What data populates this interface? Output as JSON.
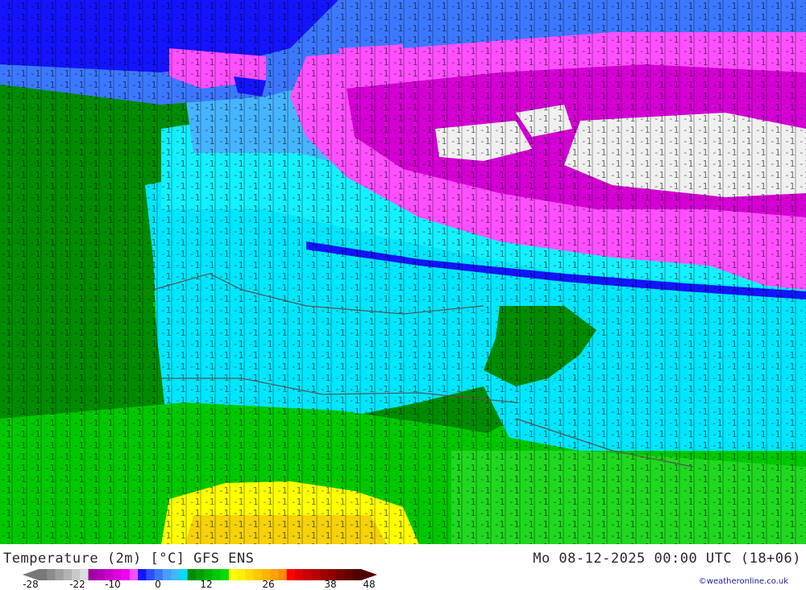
{
  "map": {
    "description_labels": [
      "Temperature (2m) [°C] GFS ENS"
    ],
    "colors": {
      "deep_purple": "#d400d4",
      "magenta": "#ff50ff",
      "light_magenta": "#ff9bff",
      "blue": "#1414ff",
      "mid_blue": "#3c78ff",
      "light_blue": "#46b4ff",
      "cyan": "#00e6ff",
      "aqua": "#14f0ff",
      "dark_green": "#008c00",
      "green": "#00c800",
      "light_green": "#20d820",
      "yellow": "#ffff00",
      "orange_yellow": "#f5d20a",
      "white_cold": "#f0f0f0"
    }
  },
  "footer": {
    "title_left": "Temperature (2m) [°C] GFS ENS",
    "title_right": "Mo 08-12-2025 00:00 UTC (18+06)",
    "credit": "©weatheronline.co.uk"
  },
  "legend": {
    "ticks": [
      "-28",
      "-22",
      "-10",
      "0",
      "12",
      "26",
      "38",
      "48"
    ],
    "colors": [
      "#787878",
      "#8c8c8c",
      "#a0a0a0",
      "#b4b4b4",
      "#c8c8c8",
      "#dcdcdc",
      "#a000a0",
      "#b400b4",
      "#c800c8",
      "#dc00dc",
      "#f000f0",
      "#ff50ff",
      "#1414ff",
      "#2850ff",
      "#3c78ff",
      "#46a0ff",
      "#46b4ff",
      "#00dcff",
      "#008c00",
      "#00a000",
      "#00b400",
      "#00c800",
      "#00dc00",
      "#ffff00",
      "#fff000",
      "#ffdc00",
      "#ffc800",
      "#ffb400",
      "#ffa000",
      "#ff8c00",
      "#ff0000",
      "#dc0000",
      "#c80000",
      "#b40000",
      "#a00000",
      "#8c0000",
      "#780000",
      "#640000",
      "#500000"
    ]
  }
}
